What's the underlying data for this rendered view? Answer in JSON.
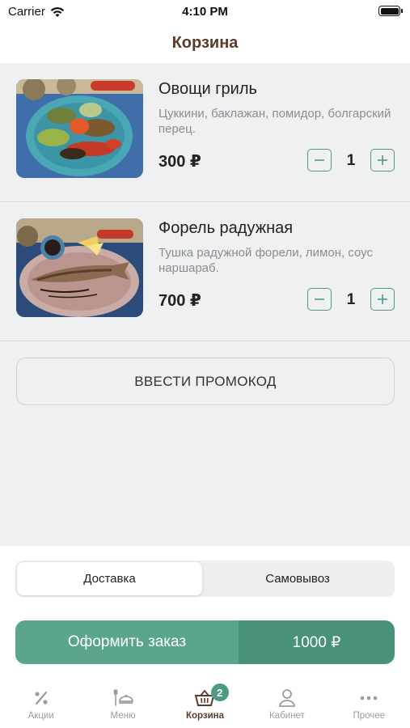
{
  "status_bar": {
    "carrier": "Carrier",
    "time": "4:10 PM"
  },
  "header": {
    "title": "Корзина"
  },
  "cart": {
    "items": [
      {
        "name": "Овощи гриль",
        "description": "Цуккини, баклажан, помидор, болгарский перец.",
        "price": "300 ₽",
        "quantity": "1"
      },
      {
        "name": "Форель радужная",
        "description": "Тушка радужной форели, лимон, соус наршараб.",
        "price": "700 ₽",
        "quantity": "1"
      }
    ],
    "promo_label": "ВВЕСТИ ПРОМОКОД"
  },
  "delivery": {
    "options": [
      "Доставка",
      "Самовывоз"
    ],
    "selected": "Доставка"
  },
  "checkout": {
    "label": "Оформить заказ",
    "total": "1000 ₽"
  },
  "tab_bar": {
    "tabs": [
      {
        "label": "Акции",
        "icon": "percent-icon"
      },
      {
        "label": "Меню",
        "icon": "menu-dish-icon"
      },
      {
        "label": "Корзина",
        "icon": "basket-icon",
        "badge": "2",
        "active": true
      },
      {
        "label": "Кабинет",
        "icon": "user-icon"
      },
      {
        "label": "Прочее",
        "icon": "more-dots-icon"
      }
    ]
  },
  "colors": {
    "accent": "#4e9a84",
    "button": "#5aa58c",
    "button_dark": "#4a9179",
    "title_brown": "#5a3b2a",
    "background": "#eff0f1"
  }
}
